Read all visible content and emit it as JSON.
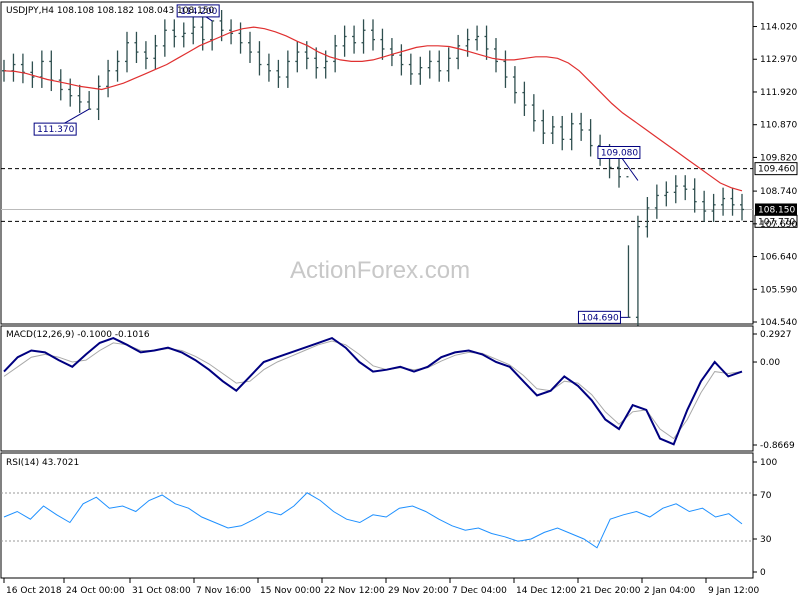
{
  "colors": {
    "bars": "#2f4f4f",
    "ma": "#e03030",
    "macd": "#000080",
    "signal": "#a9a9a9",
    "rsi": "#1e90ff",
    "frame": "#000000",
    "level": "#000000"
  },
  "watermark": "ActionForex.com",
  "main": {
    "header": "USDJPY,H4  108.108 108.182 108.043 108.150",
    "y_ticks": [
      "114.020",
      "112.970",
      "111.920",
      "110.870",
      "109.820",
      "108.740",
      "107.690",
      "106.640",
      "105.590",
      "104.540"
    ],
    "levels": [
      {
        "value": 109.46,
        "label": "109.460"
      },
      {
        "value": 107.77,
        "label": "107.770"
      }
    ],
    "current": {
      "value": 108.15,
      "label": "108.150"
    },
    "annotations": [
      "114.200",
      "111.370",
      "109.080",
      "104.690"
    ]
  },
  "macd": {
    "header": "MACD(12,26,9) -0.1000 -0.1016",
    "y_ticks": [
      "0.2927",
      "0.00",
      "-0.8669"
    ],
    "current_label": "0.00"
  },
  "rsi": {
    "header": "RSI(14) 43.7021",
    "y_ticks": [
      "100",
      "70",
      "30",
      "0"
    ]
  },
  "x_ticks": [
    "16 Oct 2018",
    "24 Oct 00:00",
    "31 Oct 08:00",
    "7 Nov 16:00",
    "15 Nov 00:00",
    "22 Nov 12:00",
    "29 Nov 20:00",
    "7 Dec 04:00",
    "14 Dec 12:00",
    "21 Dec 20:00",
    "2 Jan 04:00",
    "9 Jan 12:00"
  ],
  "chart_data": [
    {
      "type": "line",
      "title": "USDJPY,H4",
      "series": [
        {
          "name": "USDJPY",
          "values": [
            112.6,
            112.8,
            112.55,
            112.4,
            112.9,
            112.3,
            112.0,
            111.8,
            111.6,
            111.37,
            112.1,
            112.6,
            112.9,
            113.5,
            113.2,
            113.0,
            113.4,
            113.9,
            113.7,
            113.8,
            114.0,
            113.6,
            114.2,
            113.9,
            113.8,
            113.5,
            113.2,
            112.8,
            112.6,
            112.4,
            112.9,
            113.2,
            113.0,
            112.7,
            112.9,
            113.4,
            113.7,
            113.5,
            113.9,
            113.6,
            113.3,
            113.1,
            112.8,
            112.5,
            112.7,
            112.9,
            112.6,
            113.0,
            113.4,
            113.6,
            113.7,
            113.3,
            112.9,
            112.4,
            111.9,
            111.5,
            111.0,
            110.6,
            110.8,
            110.4,
            110.9,
            110.7,
            110.2,
            109.9,
            109.5,
            109.2,
            104.69,
            107.6,
            108.2,
            108.6,
            108.7,
            108.9,
            108.8,
            108.4,
            108.1,
            108.3,
            108.5,
            108.3,
            108.15
          ]
        },
        {
          "name": "MA",
          "values": [
            112.6,
            112.58,
            112.52,
            112.42,
            112.32,
            112.25,
            112.18,
            112.1,
            112.05,
            112.0,
            112.1,
            112.2,
            112.35,
            112.5,
            112.65,
            112.8,
            113.0,
            113.2,
            113.4,
            113.55,
            113.7,
            113.85,
            113.95,
            114.0,
            113.95,
            113.85,
            113.72,
            113.55,
            113.4,
            113.2,
            113.05,
            112.95,
            112.9,
            112.9,
            112.95,
            113.05,
            113.15,
            113.25,
            113.35,
            113.4,
            113.4,
            113.38,
            113.3,
            113.2,
            113.1,
            113.0,
            112.95,
            112.95,
            113.0,
            113.05,
            113.05,
            113.0,
            112.85,
            112.6,
            112.25,
            111.9,
            111.55,
            111.25,
            111.0,
            110.75,
            110.5,
            110.25,
            110.0,
            109.75,
            109.5,
            109.25,
            109.0,
            108.85,
            108.75
          ]
        }
      ],
      "annotations": [
        114.2,
        111.37,
        109.08,
        104.69
      ],
      "levels": [
        109.46,
        107.77
      ],
      "ylim": [
        104.54,
        114.55
      ]
    },
    {
      "type": "line",
      "title": "MACD(12,26,9)",
      "series": [
        {
          "name": "MACD",
          "values": [
            -0.1,
            0.05,
            0.12,
            0.1,
            0.02,
            -0.05,
            0.08,
            0.2,
            0.25,
            0.18,
            0.1,
            0.12,
            0.15,
            0.1,
            0.02,
            -0.08,
            -0.2,
            -0.3,
            -0.15,
            0.0,
            0.05,
            0.1,
            0.15,
            0.2,
            0.25,
            0.15,
            0.0,
            -0.1,
            -0.08,
            -0.05,
            -0.1,
            -0.05,
            0.05,
            0.1,
            0.12,
            0.08,
            0.0,
            -0.05,
            -0.2,
            -0.35,
            -0.3,
            -0.15,
            -0.25,
            -0.4,
            -0.6,
            -0.7,
            -0.45,
            -0.5,
            -0.8,
            -0.86,
            -0.5,
            -0.2,
            0.0,
            -0.15,
            -0.1
          ]
        },
        {
          "name": "Signal",
          "values": [
            -0.15,
            -0.05,
            0.05,
            0.08,
            0.05,
            0.0,
            0.02,
            0.12,
            0.2,
            0.18,
            0.12,
            0.12,
            0.14,
            0.12,
            0.06,
            -0.02,
            -0.12,
            -0.22,
            -0.2,
            -0.08,
            0.0,
            0.06,
            0.12,
            0.18,
            0.22,
            0.18,
            0.08,
            -0.04,
            -0.08,
            -0.06,
            -0.08,
            -0.06,
            0.01,
            0.07,
            0.1,
            0.09,
            0.03,
            -0.03,
            -0.14,
            -0.28,
            -0.3,
            -0.2,
            -0.22,
            -0.34,
            -0.52,
            -0.65,
            -0.52,
            -0.5,
            -0.7,
            -0.8,
            -0.6,
            -0.32,
            -0.1,
            -0.12,
            -0.1
          ]
        }
      ],
      "ylim": [
        -0.8669,
        0.2927
      ]
    },
    {
      "type": "line",
      "title": "RSI(14)",
      "series": [
        {
          "name": "RSI",
          "values": [
            50,
            55,
            48,
            60,
            52,
            45,
            62,
            68,
            58,
            60,
            55,
            65,
            70,
            62,
            58,
            50,
            45,
            40,
            42,
            48,
            55,
            52,
            60,
            72,
            65,
            55,
            48,
            45,
            52,
            50,
            58,
            60,
            55,
            48,
            42,
            38,
            40,
            35,
            32,
            28,
            30,
            36,
            40,
            35,
            30,
            22,
            48,
            52,
            55,
            50,
            58,
            62,
            55,
            58,
            50,
            53,
            43.7
          ]
        }
      ],
      "ylim": [
        0,
        100
      ]
    }
  ]
}
